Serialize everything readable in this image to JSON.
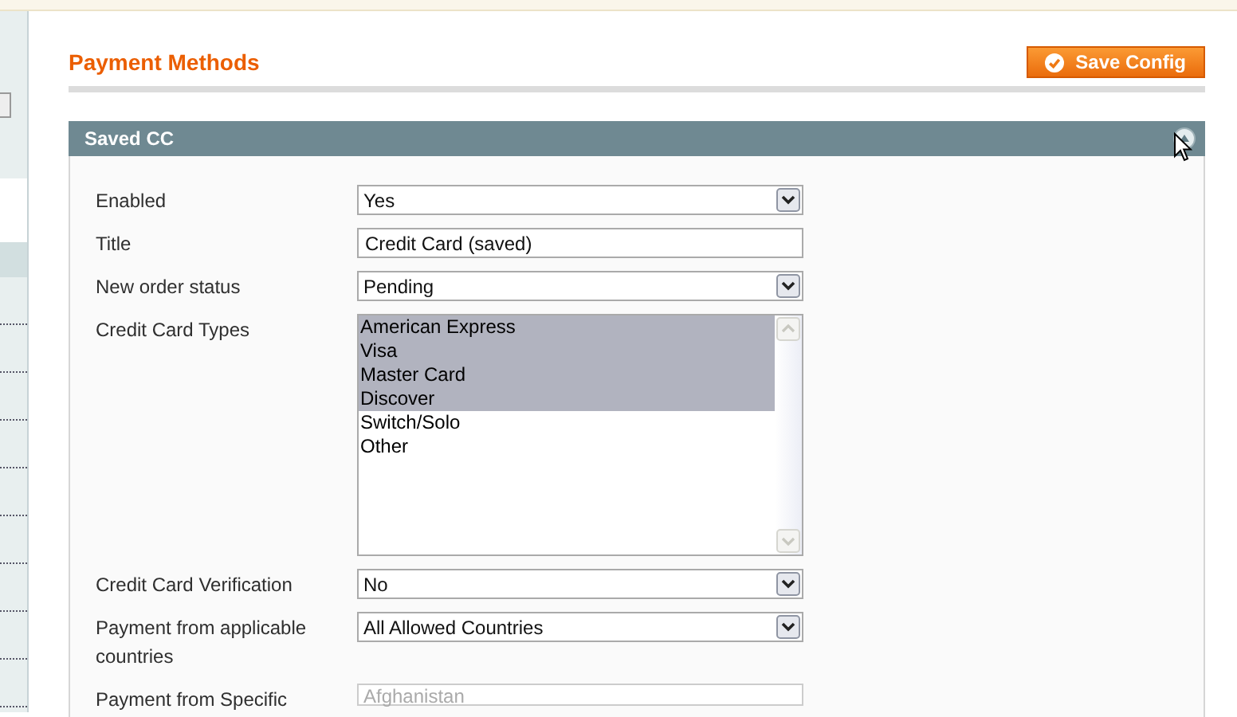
{
  "header": {
    "title": "Payment Methods",
    "save_button": "Save Config"
  },
  "section": {
    "title": "Saved CC",
    "expanded": true,
    "fields": [
      {
        "label": "Enabled",
        "kind": "select",
        "value": "Yes",
        "disabled": false
      },
      {
        "label": "Title",
        "kind": "text",
        "value": "Credit Card (saved)",
        "disabled": false
      },
      {
        "label": "New order status",
        "kind": "select",
        "value": "Pending",
        "disabled": false
      },
      {
        "label": "Credit Card Types",
        "kind": "multiselect",
        "options": [
          {
            "label": "American Express",
            "selected": true
          },
          {
            "label": "Visa",
            "selected": true
          },
          {
            "label": "Master Card",
            "selected": true
          },
          {
            "label": "Discover",
            "selected": true
          },
          {
            "label": "Switch/Solo",
            "selected": false
          },
          {
            "label": "Other",
            "selected": false
          }
        ]
      },
      {
        "label": "Credit Card Verification",
        "kind": "select",
        "value": "No",
        "disabled": false
      },
      {
        "label": "Payment from applicable countries",
        "kind": "select",
        "value": "All Allowed Countries",
        "disabled": false
      },
      {
        "label": "Payment from Specific",
        "kind": "multiselect_disabled",
        "value": "Afghanistan",
        "disabled": true
      }
    ]
  }
}
